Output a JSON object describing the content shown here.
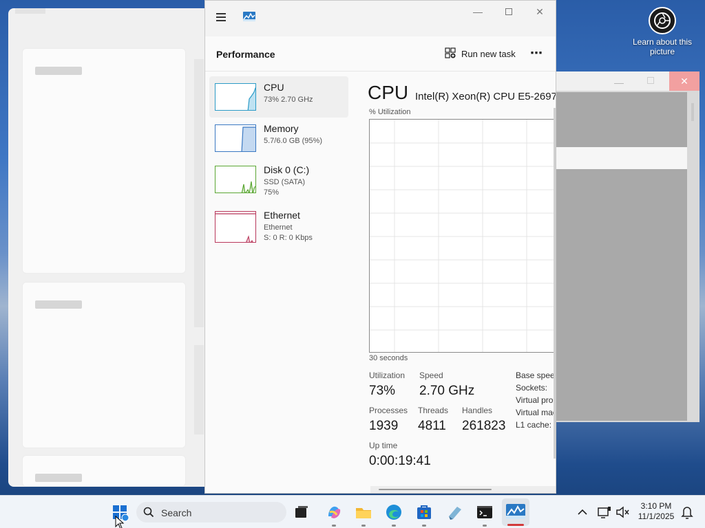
{
  "desktop": {
    "spotlight_label": "Learn about this picture"
  },
  "task_manager": {
    "header_title": "Performance",
    "run_new_task_label": "Run new task",
    "more_label": "⋯",
    "minimize_glyph": "—",
    "close_glyph": "✕",
    "sidebar": [
      {
        "name": "CPU",
        "sub1": "73%  2.70 GHz",
        "sub2": "",
        "color": "#2b9bc7"
      },
      {
        "name": "Memory",
        "sub1": "5.7/6.0 GB (95%)",
        "sub2": "",
        "color": "#3a78c2"
      },
      {
        "name": "Disk 0 (C:)",
        "sub1": "SSD (SATA)",
        "sub2": "75%",
        "color": "#5aa632"
      },
      {
        "name": "Ethernet",
        "sub1": "Ethernet",
        "sub2": "S: 0  R: 0 Kbps",
        "color": "#b8365a"
      }
    ],
    "main": {
      "title": "CPU",
      "model": "Intel(R) Xeon(R) CPU E5-2697",
      "util_label": "% Utilization",
      "time_label": "30 seconds",
      "stats": {
        "utilization_label": "Utilization",
        "utilization_value": "73%",
        "speed_label": "Speed",
        "speed_value": "2.70 GHz",
        "processes_label": "Processes",
        "processes_value": "1939",
        "threads_label": "Threads",
        "threads_value": "4811",
        "handles_label": "Handles",
        "handles_value": "261823",
        "uptime_label": "Up time",
        "uptime_value": "0:00:19:41"
      },
      "right_column": [
        "Base speed",
        "Sockets:",
        "Virtual proc",
        "Virtual mac",
        "L1 cache:"
      ]
    }
  },
  "taskbar": {
    "search_placeholder": "Search",
    "clock_time": "3:10 PM",
    "clock_date": "11/1/2025"
  }
}
